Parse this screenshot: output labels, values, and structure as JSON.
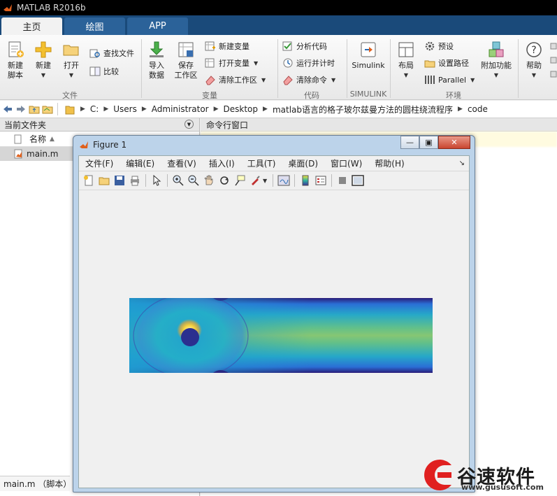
{
  "app": {
    "title": "MATLAB R2016b"
  },
  "tabs": [
    {
      "label": "主页"
    },
    {
      "label": "绘图"
    },
    {
      "label": "APP"
    }
  ],
  "ribbon": {
    "file": {
      "new_script": "新建\n脚本",
      "new": "新建",
      "open": "打开",
      "find_files": "查找文件",
      "compare": "比较",
      "group_label": "文件"
    },
    "variable": {
      "import": "导入\n数据",
      "save_workspace": "保存\n工作区",
      "new_variable": "新建变量",
      "open_variable": "打开变量",
      "clear_workspace": "清除工作区",
      "group_label": "变量"
    },
    "code": {
      "analyze": "分析代码",
      "run_time": "运行并计时",
      "clear_commands": "清除命令",
      "group_label": "代码"
    },
    "simulink": {
      "label": "Simulink",
      "group_label": "SIMULINK"
    },
    "environment": {
      "layout": "布局",
      "preferences": "预设",
      "set_path": "设置路径",
      "parallel": "Parallel",
      "addons": "附加功能",
      "group_label": "环境"
    },
    "help": {
      "label": "帮助"
    }
  },
  "address": {
    "crumbs": [
      "C:",
      "Users",
      "Administrator",
      "Desktop",
      "matlab语言的格子玻尔兹曼方法的圆柱绕流程序",
      "code"
    ]
  },
  "current_folder": {
    "title": "当前文件夹",
    "column_name": "名称",
    "files": [
      {
        "name": "main.m"
      }
    ],
    "status": "main.m （脚本）"
  },
  "command_window": {
    "title": "命令行窗口"
  },
  "figure": {
    "title": "Figure 1",
    "menus": [
      "文件(F)",
      "编辑(E)",
      "查看(V)",
      "插入(I)",
      "工具(T)",
      "桌面(D)",
      "窗口(W)",
      "帮助(H)"
    ],
    "colors": {
      "inflow": "#7fc67a",
      "cylinder": "#2b2f8f",
      "wall": "#2a1a73",
      "hot": "#f4d13c"
    }
  },
  "watermark": {
    "brand": "谷速软件",
    "url": "www.gususoft.com"
  }
}
